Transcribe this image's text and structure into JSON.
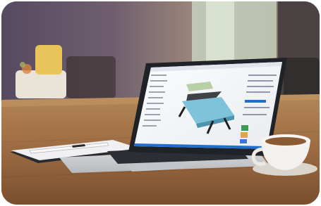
{
  "scene": {
    "colors": {
      "wall_left": "#5b4f63",
      "wall_mid": "#8e7773",
      "window": "#cfe0c7",
      "table": "#9b6a42",
      "table_dark": "#6d4529",
      "laptop_body": "#c9ccd0",
      "laptop_dark": "#23262b",
      "screen_bg": "#f4f5f7",
      "accent_blue": "#1f6fd1",
      "cup": "#f3f1ee",
      "coffee": "#8a5a33",
      "notebook": "#2a2a2e"
    },
    "icons": [
      "laptop",
      "coffee-cup",
      "notebook",
      "pen",
      "flower-vase",
      "chair"
    ]
  }
}
